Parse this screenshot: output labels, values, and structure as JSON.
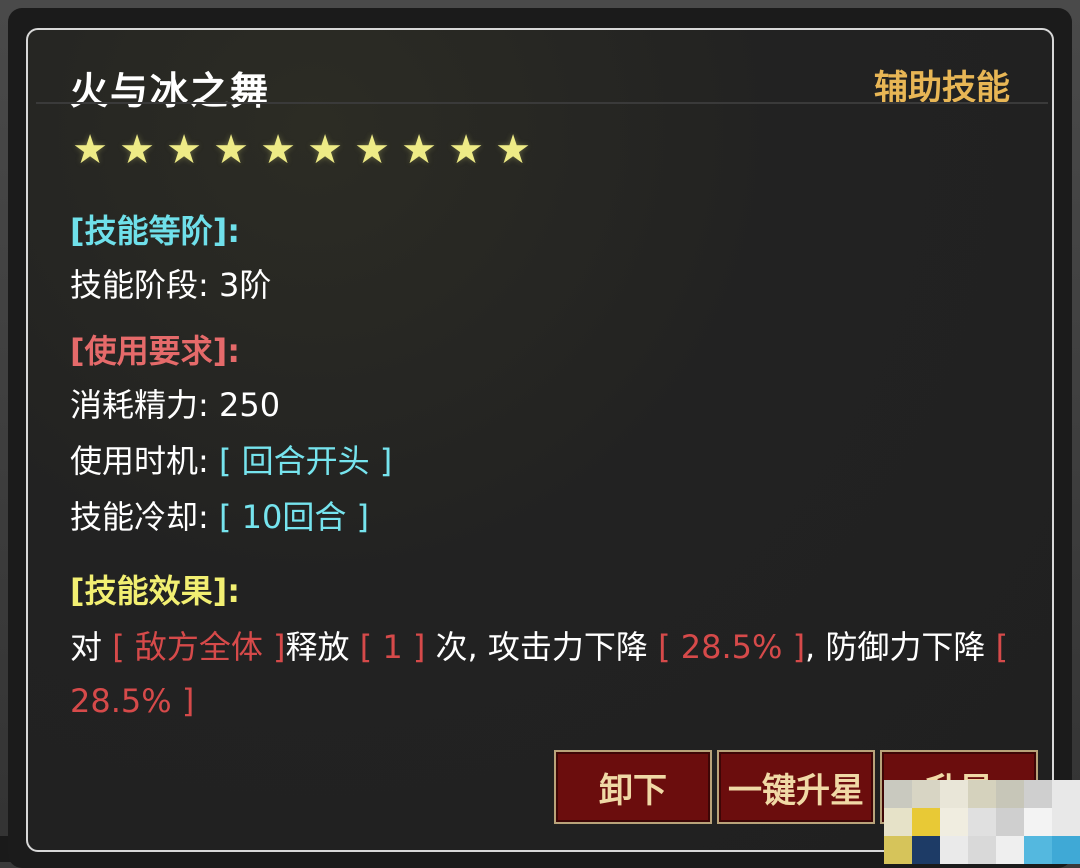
{
  "skill": {
    "name": "火与冰之舞",
    "type": "辅助技能",
    "stars": 10
  },
  "sections": {
    "grade": {
      "header": "[技能等阶]:",
      "stage_label": "技能阶段:",
      "stage_value": "3阶"
    },
    "requirements": {
      "header": "[使用要求]:",
      "energy_label": "消耗精力:",
      "energy_value": "250",
      "timing_label": "使用时机:",
      "timing_value": "[ 回合开头 ]",
      "cooldown_label": "技能冷却:",
      "cooldown_value": "[ 10回合 ]"
    },
    "effect": {
      "header": "[技能效果]:",
      "p1": "对",
      "target": "[ 敌方全体 ]",
      "p2": "释放",
      "times": "[ 1 ]",
      "p3": "次, 攻击力下降",
      "atk_down": "[ 28.5% ]",
      "p4": ", 防御力下降",
      "def_down": "[ 28.5% ]"
    }
  },
  "buttons": {
    "unequip": "卸下",
    "one_click_star": "一键升星",
    "star_up": "升星"
  },
  "colors": {
    "title": "#ffffff",
    "skill_type": "#e8b655",
    "star": "#eeeb86",
    "header_cyan": "#6fe0ea",
    "header_red": "#e56a6a",
    "header_yellow": "#f2ef72",
    "value_red": "#d64a4a",
    "button_bg": "#6b0d0d"
  }
}
